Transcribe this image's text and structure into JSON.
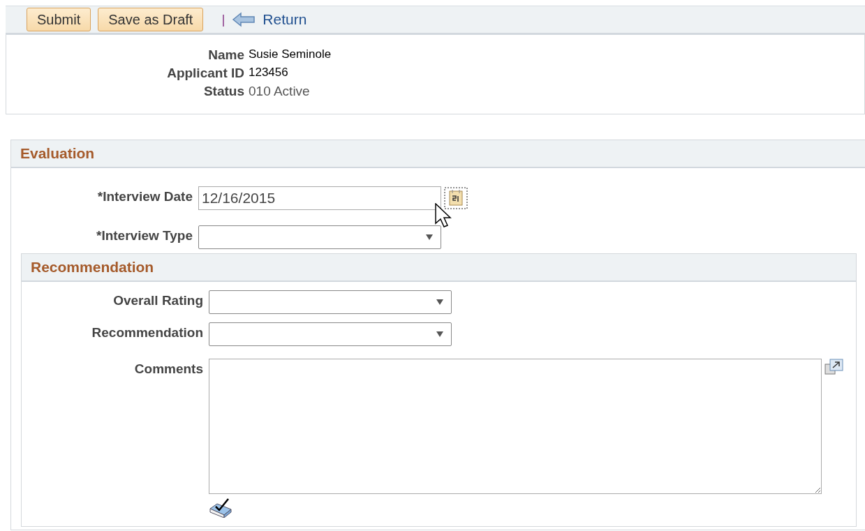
{
  "toolbar": {
    "buttons": [
      "Submit",
      "Save as Draft"
    ],
    "separator": "|",
    "return_link": "Return"
  },
  "header": {
    "fields": [
      {
        "label": "Name",
        "value": "Susie Seminole"
      },
      {
        "label": "Applicant ID",
        "value": "123456"
      },
      {
        "label": "Status",
        "value": "010 Active"
      }
    ]
  },
  "evaluation": {
    "title": "Evaluation",
    "interview_date": {
      "label": "*Interview Date",
      "value": "12/16/2015"
    },
    "interview_type": {
      "label": "*Interview Type"
    }
  },
  "recommendation": {
    "title": "Recommendation",
    "overall_rating": {
      "label": "Overall Rating"
    },
    "recommendation": {
      "label": "Recommendation"
    },
    "comments": {
      "label": "Comments"
    }
  }
}
